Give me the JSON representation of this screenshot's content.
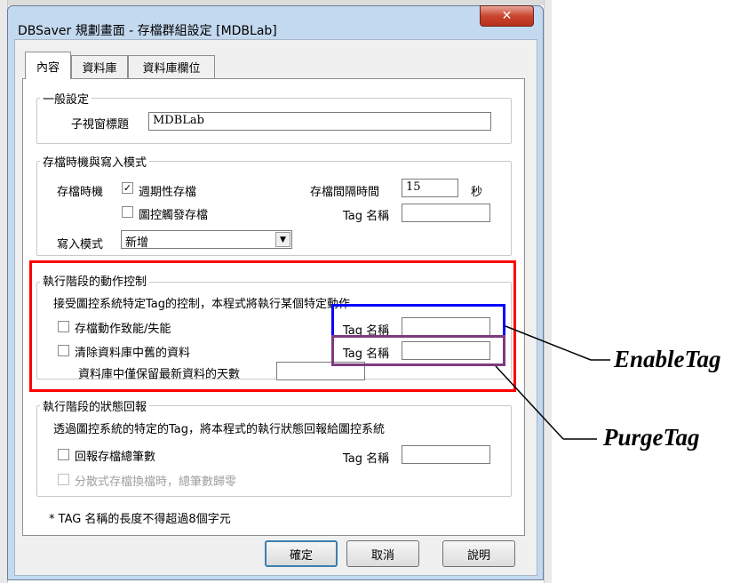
{
  "window": {
    "title": "DBSaver 規劃畫面 - 存檔群組設定 [MDBLab]",
    "close_glyph": "✕"
  },
  "tabs": [
    {
      "label": "內容",
      "active": true
    },
    {
      "label": "資料庫",
      "active": false
    },
    {
      "label": "資料庫欄位",
      "active": false
    }
  ],
  "general": {
    "legend": "一般設定",
    "subtitle_label": "子視窗標題",
    "subtitle_value": "MDBLab"
  },
  "save_mode": {
    "legend": "存檔時機與寫入模式",
    "timing_label": "存檔時機",
    "periodic_label": "週期性存檔",
    "periodic_checked": true,
    "trigger_label": "圖控觸發存檔",
    "trigger_checked": false,
    "interval_label": "存檔間隔時間",
    "interval_value": "15",
    "interval_unit": "秒",
    "tag_label": "Tag 名稱",
    "tag_value": "",
    "write_mode_label": "寫入模式",
    "write_mode_value": "新增"
  },
  "action_control": {
    "legend": "執行階段的動作控制",
    "description": "接受圖控系統特定Tag的控制，本程式將執行某個特定動作",
    "enable_label": "存檔動作致能/失能",
    "enable_checked": false,
    "enable_tag_label": "Tag 名稱",
    "enable_tag_value": "",
    "purge_label": "清除資料庫中舊的資料",
    "purge_checked": false,
    "purge_tag_label": "Tag 名稱",
    "purge_tag_value": "",
    "retain_days_label": "資料庫中僅保留最新資料的天數",
    "retain_days_value": ""
  },
  "status_report": {
    "legend": "執行階段的狀態回報",
    "description": "透過圖控系統的特定的Tag，將本程式的執行狀態回報給圖控系統",
    "report_label": "回報存檔總筆數",
    "report_checked": false,
    "tag_label": "Tag 名稱",
    "tag_value": "",
    "reset_label": "分散式存檔換檔時，總筆數歸零",
    "reset_checked": false
  },
  "note": "* TAG 名稱的長度不得超過8個字元",
  "buttons": {
    "ok": "確定",
    "cancel": "取消",
    "help": "說明"
  },
  "annotations": {
    "enable_tag": "EnableTag",
    "purge_tag": "PurgeTag"
  },
  "colors": {
    "highlight_red": "#ff0000",
    "highlight_blue": "#0000ff",
    "highlight_purple": "#7f3a7f",
    "close_button": "#c9452e"
  }
}
